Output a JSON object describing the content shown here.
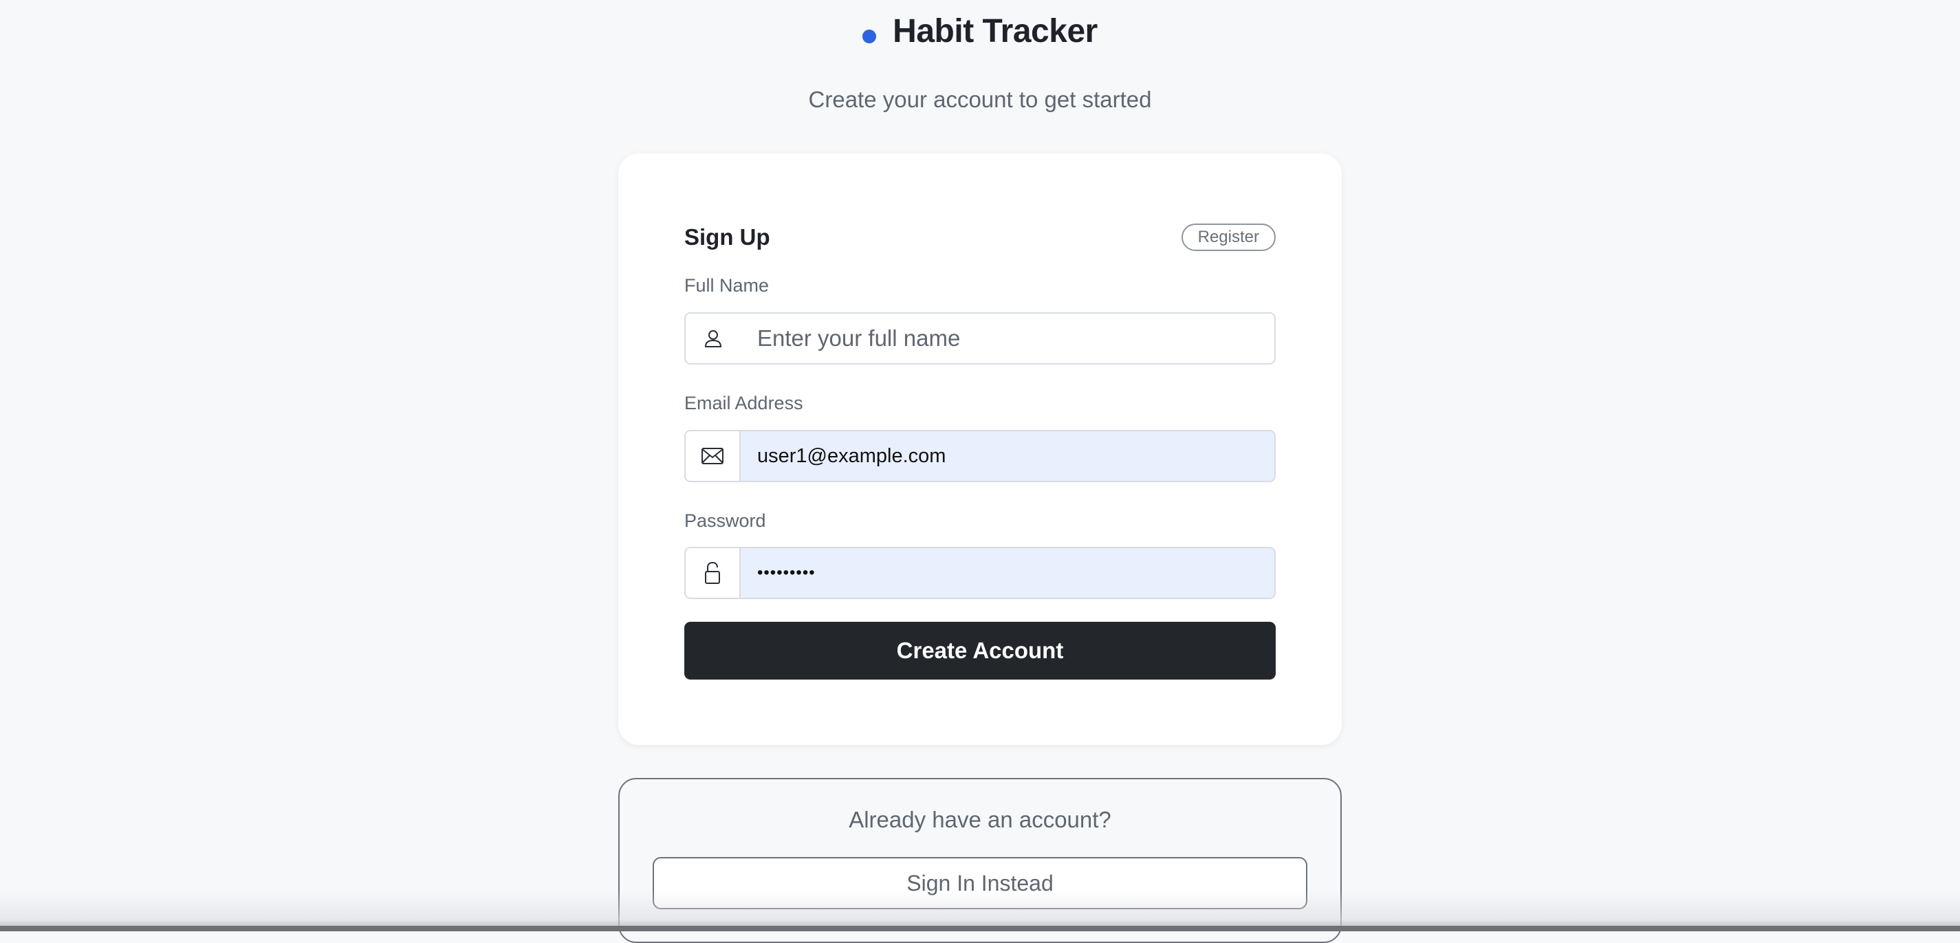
{
  "header": {
    "title": "Habit Tracker",
    "subtitle": "Create your account to get started"
  },
  "signup": {
    "title": "Sign Up",
    "badge": "Register",
    "fields": {
      "full_name": {
        "label": "Full Name",
        "placeholder": "Enter your full name",
        "value": ""
      },
      "email": {
        "label": "Email Address",
        "value": "user1@example.com"
      },
      "password": {
        "label": "Password",
        "value": "•••••••••"
      }
    },
    "submit_label": "Create Account"
  },
  "signin": {
    "prompt": "Already have an account?",
    "button_label": "Sign In Instead"
  },
  "colors": {
    "accent": "#2d63e2",
    "primary_button": "#23262b",
    "autofill_background": "#e8effd",
    "page_background": "#f7f8fa"
  },
  "icons": {
    "brand": "dot-icon",
    "full_name": "user-icon",
    "email": "envelope-icon",
    "password": "lock-icon"
  }
}
